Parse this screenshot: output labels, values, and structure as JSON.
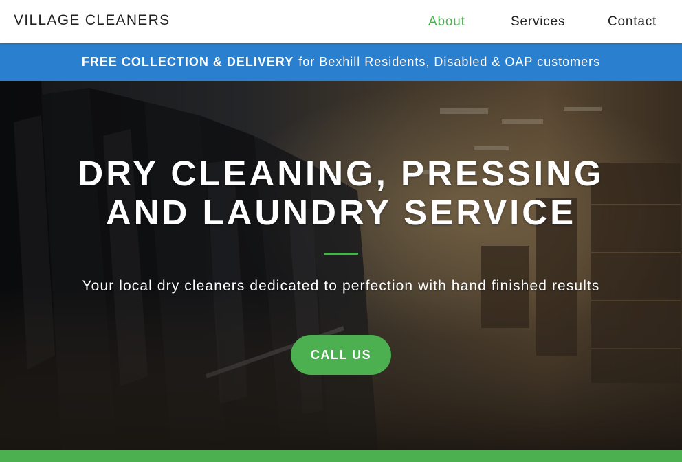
{
  "navbar": {
    "brand": "VILLAGE CLEANERS",
    "links": [
      {
        "label": "About",
        "active": true
      },
      {
        "label": "Services"
      },
      {
        "label": "Contact"
      }
    ]
  },
  "promo": {
    "bold": "FREE COLLECTION & DELIVERY",
    "text": "for Bexhill Residents, Disabled & OAP customers"
  },
  "hero": {
    "title_line1": "DRY CLEANING, PRESSING",
    "title_line2": "AND LAUNDRY SERVICE",
    "subtitle": "Your local dry cleaners dedicated to perfection with hand finished results",
    "cta": "CALL US"
  },
  "colors": {
    "accent": "#4caf50",
    "promo_bar": "#2a7fcf",
    "text_dark": "#222222",
    "hero_text": "#ffffff"
  }
}
